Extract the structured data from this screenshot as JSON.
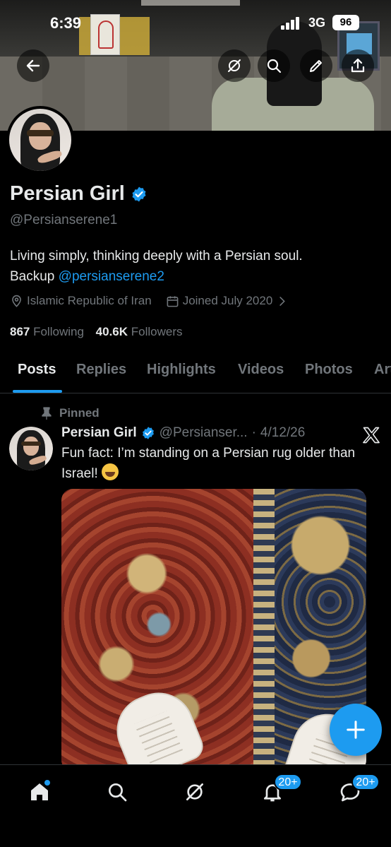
{
  "status_bar": {
    "time": "6:39",
    "network": "3G",
    "battery": "96"
  },
  "header": {
    "icons": [
      "back-arrow-icon",
      "grok-icon",
      "search-icon",
      "edit-pencil-icon",
      "share-icon"
    ]
  },
  "profile": {
    "name": "Persian Girl",
    "handle": "@Persianserene1",
    "bio_line1": "Living simply, thinking deeply with a Persian soul.",
    "bio_prefix": "Backup ",
    "bio_link": "@persianserene2",
    "location": "Islamic Republic of Iran",
    "joined": "Joined July 2020",
    "following_count": "867",
    "following_label": " Following",
    "followers_count": "40.6K",
    "followers_label": " Followers"
  },
  "tabs": [
    "Posts",
    "Replies",
    "Highlights",
    "Videos",
    "Photos",
    "Articles"
  ],
  "active_tab": "Posts",
  "post": {
    "pinned_label": "Pinned",
    "author_name": "Persian Girl",
    "author_handle": "@Persianser...",
    "separator": " · ",
    "date": "4/12/26",
    "text": "Fun fact: I’m standing on a Persian rug older than Israel!"
  },
  "bottom_nav": {
    "notifications_badge": "20+",
    "messages_badge": "20+"
  },
  "colors": {
    "accent": "#1d9bf0",
    "background": "#000000",
    "secondary_text": "#71767b",
    "primary_text": "#e7e9ea"
  }
}
